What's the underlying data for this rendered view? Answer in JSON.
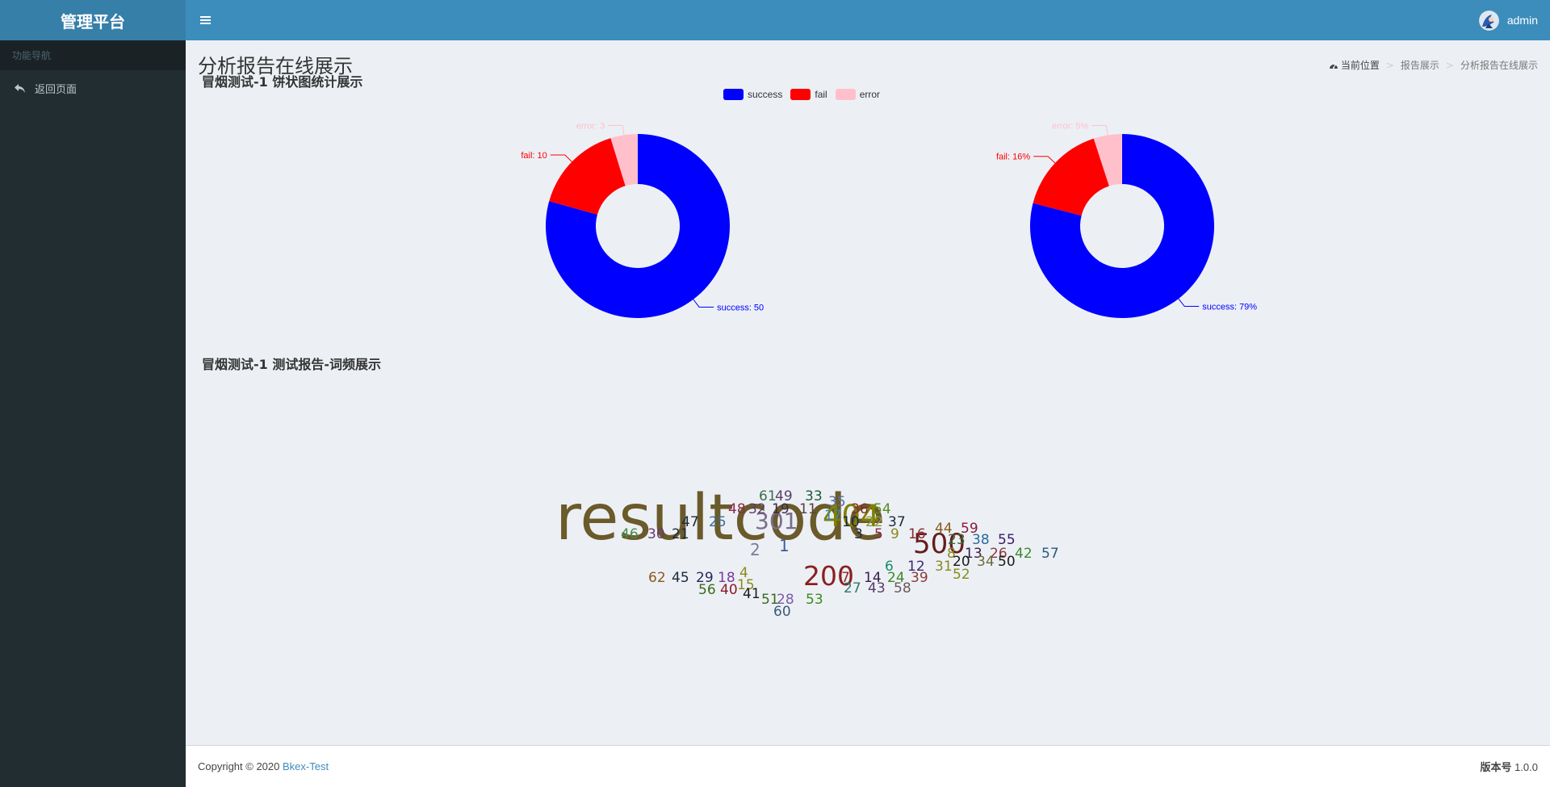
{
  "app": {
    "title": "管理平台"
  },
  "sidebar": {
    "header": "功能导航",
    "items": [
      {
        "label": "返回页面",
        "icon": "reply-icon"
      }
    ]
  },
  "topbar": {
    "username": "admin"
  },
  "page": {
    "title": "分析报告在线展示",
    "breadcrumb": [
      "当前位置",
      "报告展示",
      "分析报告在线展示"
    ]
  },
  "pie_section": {
    "title": "冒烟测试-1 饼状图统计展示"
  },
  "wordcloud_section": {
    "title": "冒烟测试-1 测试报告-词频展示"
  },
  "legend": [
    {
      "name": "success",
      "color": "#0000ff"
    },
    {
      "name": "fail",
      "color": "#ff0000"
    },
    {
      "name": "error",
      "color": "#ffc0cb"
    }
  ],
  "chart_data": [
    {
      "type": "pie",
      "labels": [
        "success",
        "fail",
        "error"
      ],
      "values": [
        50,
        10,
        3
      ],
      "colors": [
        "#0000ff",
        "#ff0000",
        "#ffc0cb"
      ],
      "donut": true,
      "data_labels": [
        "success: 50",
        "fail: 10",
        "error: 3"
      ]
    },
    {
      "type": "pie",
      "labels": [
        "success",
        "fail",
        "error"
      ],
      "values": [
        79,
        16,
        5
      ],
      "colors": [
        "#0000ff",
        "#ff0000",
        "#ffc0cb"
      ],
      "donut": true,
      "data_labels": [
        "success: 79%",
        "fail: 16%",
        "error: 5%"
      ]
    }
  ],
  "wordcloud": {
    "words": [
      "resultcode",
      "404",
      "500",
      "200",
      "301",
      "2",
      "1",
      "61",
      "49",
      "33",
      "35",
      "48",
      "32",
      "19",
      "11",
      "17",
      "36",
      "54",
      "47",
      "25",
      "10",
      "22",
      "37",
      "46",
      "30",
      "21",
      "3",
      "5",
      "9",
      "16",
      "44",
      "59",
      "23",
      "38",
      "55",
      "8",
      "13",
      "26",
      "42",
      "57",
      "6",
      "12",
      "31",
      "20",
      "34",
      "50",
      "52",
      "62",
      "45",
      "29",
      "18",
      "4",
      "15",
      "7",
      "14",
      "24",
      "39",
      "56",
      "40",
      "41",
      "27",
      "43",
      "58",
      "51",
      "28",
      "53",
      "60"
    ]
  },
  "footer": {
    "copyright": "Copyright © 2020",
    "brand": "Bkex-Test",
    "version_label": "版本号",
    "version": "1.0.0"
  }
}
